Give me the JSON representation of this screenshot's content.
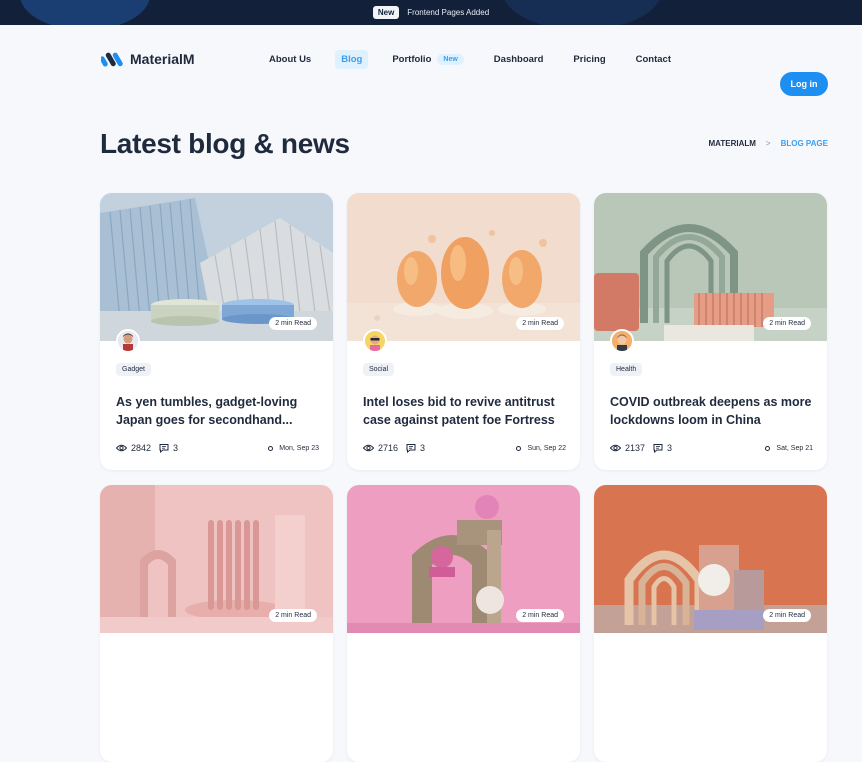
{
  "announcement": {
    "tag": "New",
    "message": "Frontend Pages Added"
  },
  "brand": {
    "name": "MaterialM",
    "accent": "#1d8ff2"
  },
  "nav": {
    "items": [
      {
        "label": "About Us"
      },
      {
        "label": "Blog"
      },
      {
        "label": "Portfolio",
        "badge": "New"
      },
      {
        "label": "Dashboard"
      },
      {
        "label": "Pricing"
      },
      {
        "label": "Contact"
      }
    ],
    "login_label": "Log in"
  },
  "page": {
    "title": "Latest blog & news"
  },
  "breadcrumb": {
    "root": "MATERIALM",
    "separator": ">",
    "current": "BLOG PAGE"
  },
  "posts": [
    {
      "read_time": "2 min Read",
      "category": "Gadget",
      "title": "As yen tumbles, gadget-loving Japan goes for secondhand...",
      "views": "2842",
      "comments": "3",
      "date": "Mon, Sep 23"
    },
    {
      "read_time": "2 min Read",
      "category": "Social",
      "title": "Intel loses bid to revive antitrust case against patent foe Fortress",
      "views": "2716",
      "comments": "3",
      "date": "Sun, Sep 22"
    },
    {
      "read_time": "2 min Read",
      "category": "Health",
      "title": "COVID outbreak deepens as more lockdowns loom in China",
      "views": "2137",
      "comments": "3",
      "date": "Sat, Sep 21"
    },
    {
      "read_time": "2 min Read"
    },
    {
      "read_time": "2 min Read"
    },
    {
      "read_time": "2 min Read"
    }
  ]
}
